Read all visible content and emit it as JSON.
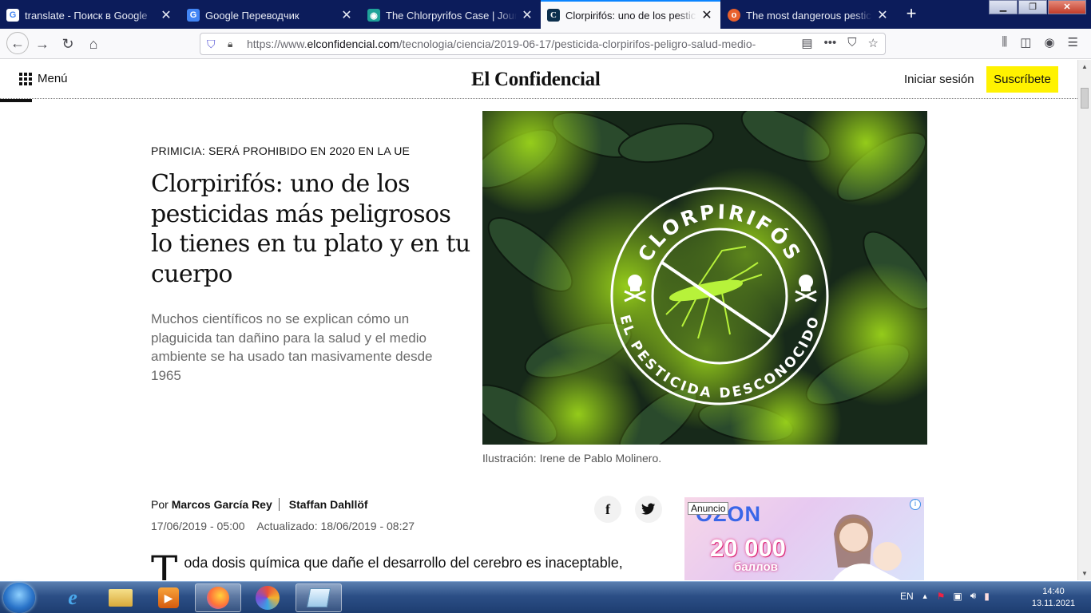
{
  "browser": {
    "tabs": [
      {
        "title": "translate - Поиск в Google",
        "favicon": "google-icon",
        "active": false
      },
      {
        "title": "Google Переводчик",
        "favicon": "google-translate-icon",
        "active": false
      },
      {
        "title": "The Chlorpyrifos Case | Journal",
        "favicon": "journal-icon",
        "active": false
      },
      {
        "title": "Clorpirifós: uno de los pesticidas",
        "favicon": "el-confidencial-icon",
        "active": true
      },
      {
        "title": "The most dangerous pesticide",
        "favicon": "orange-o-icon",
        "active": false
      }
    ],
    "url_prefix": "https://www.",
    "url_domain": "elconfidencial.com",
    "url_path": "/tecnologia/ciencia/2019-06-17/pesticida-clorpirifos-peligro-salud-medio-",
    "accent": "#0a84ff"
  },
  "site": {
    "menu_label": "Menú",
    "logo": "El Confidencial",
    "login_label": "Iniciar sesión",
    "subscribe_label": "Suscríbete",
    "subscribe_color": "#fff200"
  },
  "article": {
    "kicker": "PRIMICIA: SERÁ PROHIBIDO EN 2020 EN LA UE",
    "headline": "Clorpirifós: uno de los pesticidas más peligrosos lo tienes en tu plato y en tu cuerpo",
    "lede": "Muchos científicos no se explican cómo un plaguicida tan dañino para la salud y el medio ambiente se ha usado tan masivamente desde 1965",
    "hero_top_text": "CLORPIRIFÓS",
    "hero_bottom_text": "EL PESTICIDA DESCONOCIDO",
    "caption": "Ilustración: Irene de Pablo Molinero.",
    "byline_prefix": "Por",
    "author1": "Marcos García Rey",
    "author2": "Staffan Dahllöf",
    "published": "17/06/2019 - 05:00",
    "updated": "Actualizado: 18/06/2019 - 08:27",
    "dropcap": "T",
    "body_start": "oda dosis química que dañe el desarrollo del cerebro es inaceptable, según"
  },
  "ad": {
    "label": "Anuncio",
    "brand": "OZON",
    "points": "20 000",
    "points_sub": "баллов"
  },
  "taskbar": {
    "lang": "EN",
    "time": "14:40",
    "date": "13.11.2021"
  }
}
